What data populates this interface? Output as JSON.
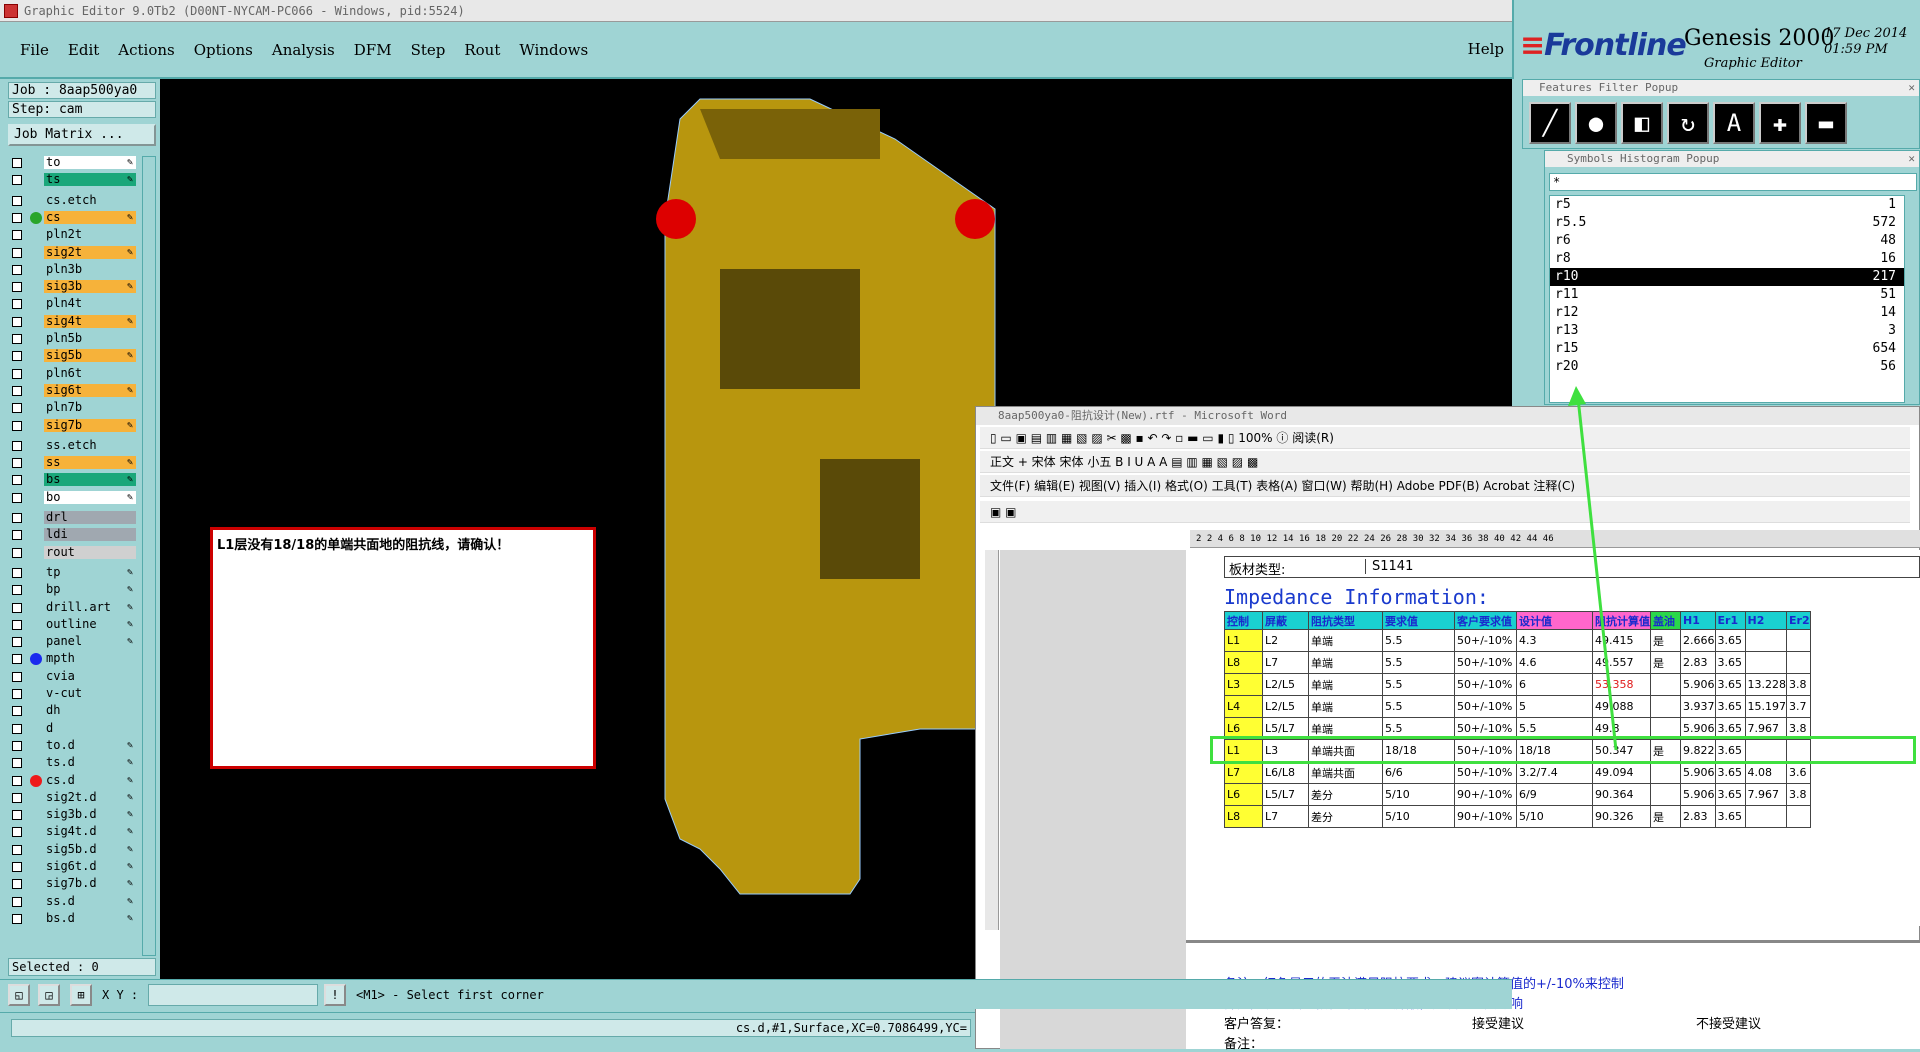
{
  "window": {
    "title": "Graphic Editor 9.0Tb2 (D00NT-NYCAM-PC066 - Windows, pid:5524)"
  },
  "menu": {
    "items": [
      "File",
      "Edit",
      "Actions",
      "Options",
      "Analysis",
      "DFM",
      "Step",
      "Rout",
      "Windows"
    ],
    "help": "Help"
  },
  "brand": {
    "logo": "Frontline",
    "product": "Genesis 2000",
    "subtitle": "Graphic Editor",
    "date": "17 Dec 2014",
    "time": "01:59 PM"
  },
  "job": {
    "job_label": "Job : 8aap500ya0",
    "step_label": "Step: cam",
    "matrix_button": "Job Matrix ..."
  },
  "layers": [
    {
      "name": "to",
      "color": "#ffffff",
      "pen": true
    },
    {
      "name": "ts",
      "color": "#1aa77a",
      "pen": true
    },
    {
      "name": "cs.etch",
      "color": "#9fd4d4",
      "pen": false
    },
    {
      "name": "cs",
      "color": "#f6b23a",
      "pen": true,
      "dot": "#2aa52a"
    },
    {
      "name": "pln2t",
      "color": "#9fd4d4",
      "pen": false
    },
    {
      "name": "sig2t",
      "color": "#f6b23a",
      "pen": true
    },
    {
      "name": "pln3b",
      "color": "#9fd4d4",
      "pen": false
    },
    {
      "name": "sig3b",
      "color": "#f6b23a",
      "pen": true
    },
    {
      "name": "pln4t",
      "color": "#9fd4d4",
      "pen": false
    },
    {
      "name": "sig4t",
      "color": "#f6b23a",
      "pen": true
    },
    {
      "name": "pln5b",
      "color": "#9fd4d4",
      "pen": false
    },
    {
      "name": "sig5b",
      "color": "#f6b23a",
      "pen": true
    },
    {
      "name": "pln6t",
      "color": "#9fd4d4",
      "pen": false
    },
    {
      "name": "sig6t",
      "color": "#f6b23a",
      "pen": true
    },
    {
      "name": "pln7b",
      "color": "#9fd4d4",
      "pen": false
    },
    {
      "name": "sig7b",
      "color": "#f6b23a",
      "pen": true
    },
    {
      "name": "ss.etch",
      "color": "#9fd4d4",
      "pen": false
    },
    {
      "name": "ss",
      "color": "#f6b23a",
      "pen": true
    },
    {
      "name": "bs",
      "color": "#1aa77a",
      "pen": true
    },
    {
      "name": "bo",
      "color": "#ffffff",
      "pen": true
    },
    {
      "name": "drl",
      "color": "#a0a8b0",
      "pen": false
    },
    {
      "name": "ldi",
      "color": "#a0a8b0",
      "pen": false
    },
    {
      "name": "rout",
      "color": "#d0d0d0",
      "pen": false
    },
    {
      "name": "tp",
      "color": "#9fd4d4",
      "pen": true
    },
    {
      "name": "bp",
      "color": "#9fd4d4",
      "pen": true
    },
    {
      "name": "drill.art",
      "color": "#9fd4d4",
      "pen": true
    },
    {
      "name": "outline",
      "color": "#9fd4d4",
      "pen": true
    },
    {
      "name": "panel",
      "color": "#9fd4d4",
      "pen": true
    },
    {
      "name": "mpth",
      "color": "#9fd4d4",
      "pen": false,
      "dot": "#1a2aee"
    },
    {
      "name": "cvia",
      "color": "#9fd4d4",
      "pen": false
    },
    {
      "name": "v-cut",
      "color": "#9fd4d4",
      "pen": false
    },
    {
      "name": "dh",
      "color": "#9fd4d4",
      "pen": false
    },
    {
      "name": "d",
      "color": "#9fd4d4",
      "pen": false
    },
    {
      "name": "to.d",
      "color": "#9fd4d4",
      "pen": true
    },
    {
      "name": "ts.d",
      "color": "#9fd4d4",
      "pen": true
    },
    {
      "name": "cs.d",
      "color": "#9fd4d4",
      "pen": true,
      "dot": "#ee1a1a"
    },
    {
      "name": "sig2t.d",
      "color": "#9fd4d4",
      "pen": true
    },
    {
      "name": "sig3b.d",
      "color": "#9fd4d4",
      "pen": true
    },
    {
      "name": "sig4t.d",
      "color": "#9fd4d4",
      "pen": true
    },
    {
      "name": "sig5b.d",
      "color": "#9fd4d4",
      "pen": true
    },
    {
      "name": "sig6t.d",
      "color": "#9fd4d4",
      "pen": true
    },
    {
      "name": "sig7b.d",
      "color": "#9fd4d4",
      "pen": true
    },
    {
      "name": "ss.d",
      "color": "#9fd4d4",
      "pen": true
    },
    {
      "name": "bs.d",
      "color": "#9fd4d4",
      "pen": true
    }
  ],
  "selected": "Selected : 0",
  "note": "L1层没有18/18的单端共面地的阻抗线，请确认！",
  "features_filter": {
    "title": "Features Filter Popup"
  },
  "symbols_histogram": {
    "title": "Symbols Histogram Popup",
    "filter": "*",
    "rows": [
      {
        "sym": "r5",
        "count": "1"
      },
      {
        "sym": "r5.5",
        "count": "572"
      },
      {
        "sym": "r6",
        "count": "48"
      },
      {
        "sym": "r8",
        "count": "16"
      },
      {
        "sym": "r10",
        "count": "217",
        "selected": true
      },
      {
        "sym": "r11",
        "count": "51"
      },
      {
        "sym": "r12",
        "count": "14"
      },
      {
        "sym": "r13",
        "count": "3"
      },
      {
        "sym": "r15",
        "count": "654"
      },
      {
        "sym": "r20",
        "count": "56"
      }
    ]
  },
  "word": {
    "title": "8aap500ya0-阻抗设计(New).rtf - Microsoft Word",
    "format_bar": "正文 + 宋体    宋体              小五",
    "menu": "文件(F)   编辑(E)   视图(V)   插入(I)   格式(O)   工具(T)   表格(A)   窗口(W)   帮助(H)   Adobe PDF(B)   Acrobat 注释(C)",
    "zoom": "100%",
    "read_btn": "阅读(R)",
    "ruler": "2    2    4    6    8   10   12   14   16   18   20   22   24   26   28   30   32   34   36   38   40   42   44   46",
    "board_label": "板材类型:",
    "board_value": "S1141",
    "imp_title": "Impedance Information:",
    "headers": [
      "控制",
      "屏蔽",
      "阻抗类型",
      "要求值",
      "客户要求值",
      "设计值",
      "阻抗计算值",
      "盖油",
      "H1",
      "Er1",
      "H2",
      "Er2"
    ],
    "rows": [
      [
        "L1",
        "L2",
        "单端",
        "5.5",
        "50+/-10%",
        "4.3",
        "49.415",
        "是",
        "2.666",
        "3.65",
        "",
        ""
      ],
      [
        "L8",
        "L7",
        "单端",
        "5.5",
        "50+/-10%",
        "4.6",
        "49.557",
        "是",
        "2.83",
        "3.65",
        "",
        ""
      ],
      [
        "L3",
        "L2/L5",
        "单端",
        "5.5",
        "50+/-10%",
        "6",
        "53.358",
        "",
        "5.906",
        "3.65",
        "13.228",
        "3.8"
      ],
      [
        "L4",
        "L2/L5",
        "单端",
        "5.5",
        "50+/-10%",
        "5",
        "49.088",
        "",
        "3.937",
        "3.65",
        "15.197",
        "3.7"
      ],
      [
        "L6",
        "L5/L7",
        "单端",
        "5.5",
        "50+/-10%",
        "5.5",
        "49.8",
        "",
        "5.906",
        "3.65",
        "7.967",
        "3.8"
      ],
      [
        "L1",
        "L3",
        "单端共面",
        "18/18",
        "50+/-10%",
        "18/18",
        "50.347",
        "是",
        "9.822",
        "3.65",
        "",
        ""
      ],
      [
        "L7",
        "L6/L8",
        "单端共面",
        "6/6",
        "50+/-10%",
        "3.2/7.4",
        "49.094",
        "",
        "5.906",
        "3.65",
        "4.08",
        "3.6"
      ],
      [
        "L6",
        "L5/L7",
        "差分",
        "5/10",
        "90+/-10%",
        "6/9",
        "90.364",
        "",
        "5.906",
        "3.65",
        "7.967",
        "3.8"
      ],
      [
        "L8",
        "L7",
        "差分",
        "5/10",
        "90+/-10%",
        "5/10",
        "90.326",
        "是",
        "2.83",
        "3.65",
        "",
        ""
      ]
    ],
    "remark1": "备注：红色显示的无法满足阻抗要求，建议案计算值的+/-10%来控制",
    "remark2": "部分阻抗线没有被参考层完全屏蔽，建议忽略其影响",
    "reply": "客户答复：",
    "accept": "接受建议",
    "reject": "不接受建议",
    "remark3": "备注："
  },
  "bottom": {
    "xy_label": "X Y :",
    "prompt": "<M1> - Select first corner"
  },
  "status": "cs.d,#1,Surface,XC=0.7086499,YC="
}
